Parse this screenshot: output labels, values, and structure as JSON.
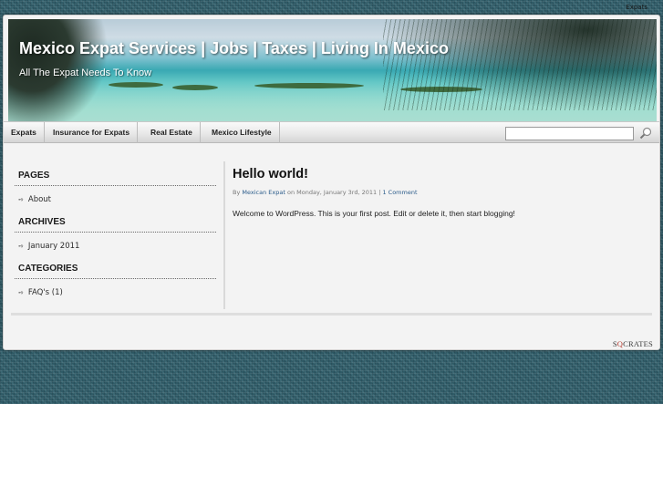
{
  "top_bar": {
    "link": "Expats"
  },
  "header": {
    "title": "Mexico Expat Services | Jobs | Taxes | Living In Mexico",
    "tagline": "All The Expat Needs To Know"
  },
  "nav": {
    "items": [
      {
        "label": "Expats"
      },
      {
        "label": "Insurance for Expats"
      },
      {
        "label": "Real Estate"
      },
      {
        "label": "Mexico Lifestyle"
      }
    ],
    "search": {
      "value": "",
      "icon": "search-icon"
    }
  },
  "sidebar": {
    "sections": [
      {
        "heading": "PAGES",
        "items": [
          "About"
        ]
      },
      {
        "heading": "ARCHIVES",
        "items": [
          "January 2011"
        ]
      },
      {
        "heading": "CATEGORIES",
        "items": [
          "FAQ's (1)"
        ]
      }
    ]
  },
  "post": {
    "title": "Hello world!",
    "meta_by": "By",
    "author": "Mexican Expat",
    "meta_on": "on Monday, January 3rd, 2011 |",
    "comments": "1 Comment",
    "body": "Welcome to WordPress. This is your first post. Edit or delete it, then start blogging!"
  },
  "footer": {
    "credit_pre": "S",
    "credit_o": "Q",
    "credit_post": "CRATES"
  },
  "colors": {
    "backdrop": "#2f5a66",
    "link": "#2a5b8a"
  }
}
